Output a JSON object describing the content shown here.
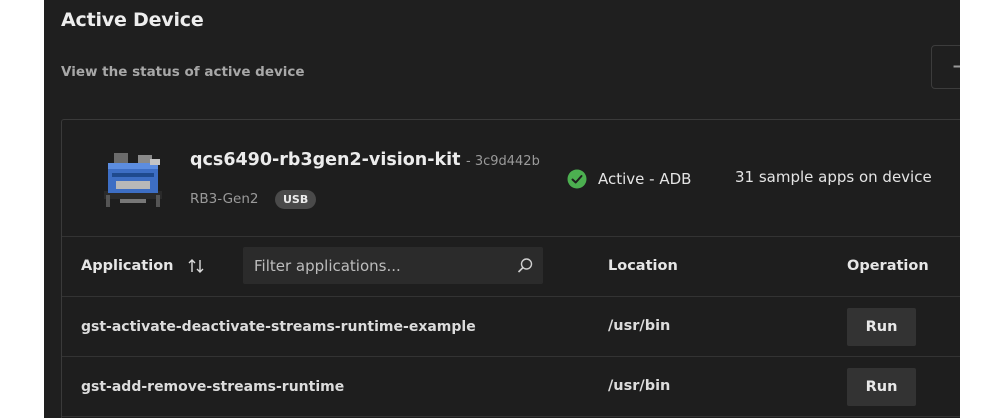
{
  "header": {
    "title": "Active Device",
    "subtitle": "View the status of active device",
    "add_label": "+"
  },
  "device": {
    "name": "qcs6490-rb3gen2-vision-kit",
    "id": "- 3c9d442b",
    "model": "RB3-Gen2",
    "connection_badge": "USB",
    "status": "Active - ADB",
    "sample_count_text": "31 sample apps on device",
    "status_color": "#4caf50"
  },
  "table": {
    "columns": {
      "application": "Application",
      "location": "Location",
      "operation": "Operation"
    },
    "filter_placeholder": "Filter applications...",
    "rows": [
      {
        "application": "gst-activate-deactivate-streams-runtime-example",
        "location": "/usr/bin",
        "operation": "Run"
      },
      {
        "application": "gst-add-remove-streams-runtime",
        "location": "/usr/bin",
        "operation": "Run"
      }
    ]
  },
  "icons": {
    "sort": "sort-arrows-icon",
    "search": "search-icon",
    "status": "check-circle-icon",
    "device": "device-board-icon"
  }
}
